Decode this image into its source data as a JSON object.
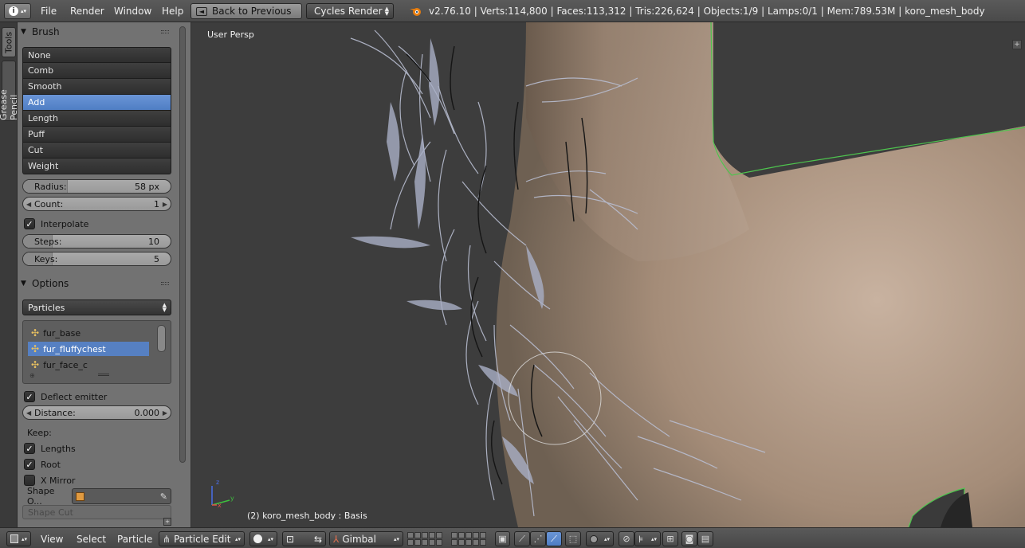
{
  "header": {
    "editor_type_icon": "info-icon",
    "menus": [
      "File",
      "Render",
      "Window",
      "Help"
    ],
    "back_button": "Back to Previous",
    "render_engine": "Cycles Render",
    "stats": "v2.76.10 | Verts:114,800 | Faces:113,312 | Tris:226,624 | Objects:1/9 | Lamps:0/1 | Mem:789.53M | koro_mesh_body"
  },
  "tabs": [
    "Tools",
    "Grease Pencil"
  ],
  "brush_panel": {
    "title": "Brush",
    "brushes": [
      "None",
      "Comb",
      "Smooth",
      "Add",
      "Length",
      "Puff",
      "Cut",
      "Weight"
    ],
    "active_brush": "Add",
    "radius": {
      "label": "Radius:",
      "value": "58 px",
      "fill_fraction": 0.3
    },
    "count": {
      "label": "Count:",
      "value": "1"
    },
    "interpolate": {
      "label": "Interpolate",
      "checked": true
    },
    "steps": {
      "label": "Steps:",
      "value": "10",
      "fill_fraction": 0.2
    },
    "keys": {
      "label": "Keys:",
      "value": "5",
      "fill_fraction": 0.2
    }
  },
  "options_panel": {
    "title": "Options",
    "mode": "Particles",
    "particle_systems": [
      "fur_base",
      "fur_fluffychest",
      "fur_face_c"
    ],
    "active_system": "fur_fluffychest",
    "deflect_emitter": {
      "label": "Deflect emitter",
      "checked": true
    },
    "distance": {
      "label": "Distance:",
      "value": "0.000"
    },
    "keep_label": "Keep:",
    "lengths": {
      "label": "Lengths",
      "checked": true
    },
    "root": {
      "label": "Root",
      "checked": true
    },
    "x_mirror": {
      "label": "X Mirror",
      "checked": false
    },
    "shape_object_label": "Shape O...",
    "shape_cut": "Shape Cut"
  },
  "viewport": {
    "view_label": "User Persp",
    "object_label": "(2) koro_mesh_body : Basis",
    "axis_labels": [
      "x",
      "y",
      "z"
    ]
  },
  "bottombar": {
    "view": "View",
    "select": "Select",
    "particle": "Particle",
    "mode": "Particle Edit",
    "orientation": "Gimbal"
  },
  "colors": {
    "accent": "#5680c2",
    "mesh_skin": "#b8a08a",
    "fur": "#b6bcd0",
    "outline": "#4ec44e"
  }
}
